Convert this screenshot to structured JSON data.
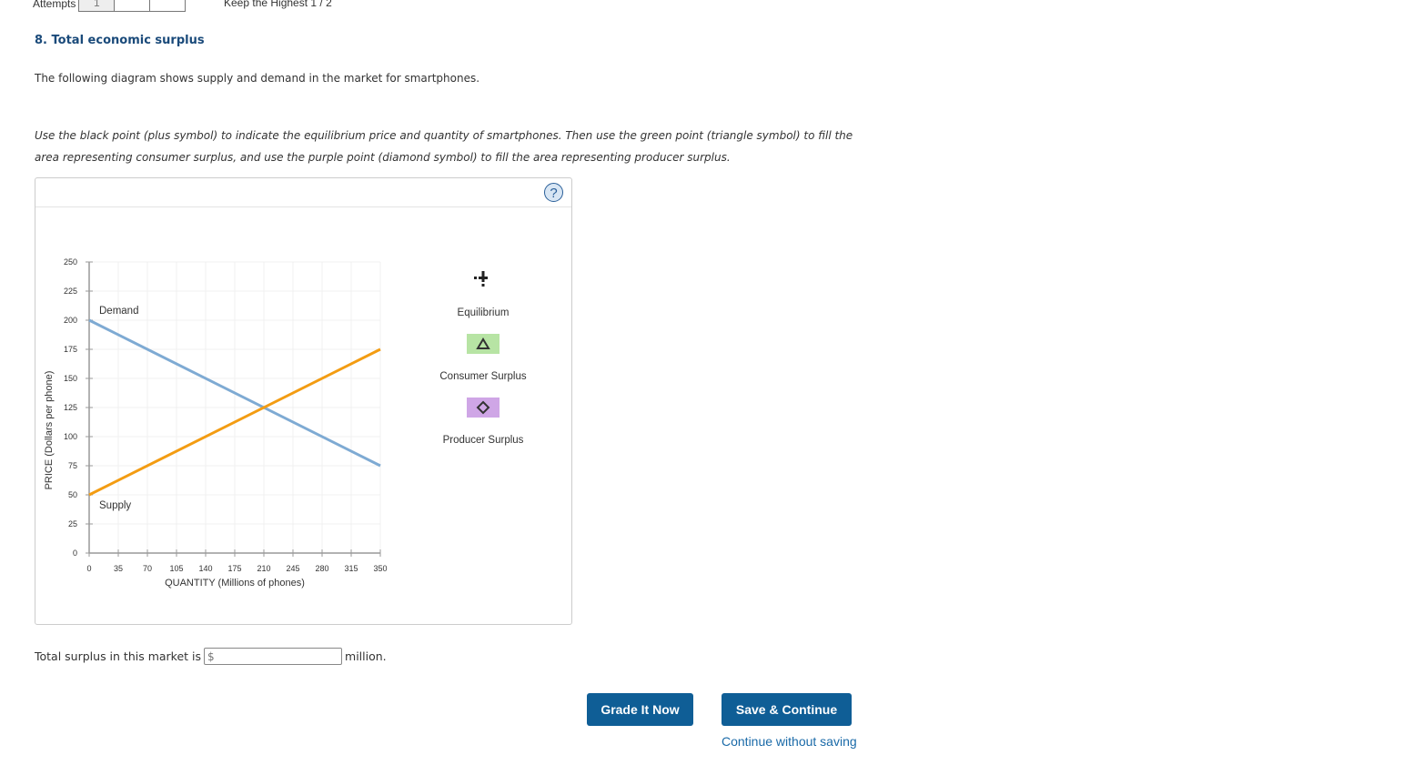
{
  "header": {
    "attempts_label": "Attempts",
    "attempts_boxes": [
      "1",
      "",
      ""
    ],
    "keep_highest": "Keep the Highest 1 / 2"
  },
  "question": {
    "title": "8. Total economic surplus",
    "intro": "The following diagram shows supply and demand in the market for smartphones.",
    "instructions": "Use the black point (plus symbol) to indicate the equilibrium price and quantity of smartphones. Then use the green point (triangle symbol) to fill the area representing consumer surplus, and use the purple point (diamond symbol) to fill the area representing producer surplus."
  },
  "graph": {
    "help_label": "?",
    "palette": [
      {
        "label": "Equilibrium",
        "icon": "plus-icon",
        "color": "#222222"
      },
      {
        "label": "Consumer Surplus",
        "icon": "triangle-icon",
        "color": "#b7e4a4"
      },
      {
        "label": "Producer Surplus",
        "icon": "diamond-icon",
        "color": "#cfa6e6"
      }
    ]
  },
  "chart_data": {
    "type": "line",
    "title": "",
    "xlabel": "QUANTITY (Millions of phones)",
    "ylabel": "PRICE (Dollars per phone)",
    "xlim": [
      0,
      350
    ],
    "ylim": [
      0,
      250
    ],
    "x_ticks": [
      0,
      35,
      70,
      105,
      140,
      175,
      210,
      245,
      280,
      315,
      350
    ],
    "y_ticks": [
      0,
      25,
      50,
      75,
      100,
      125,
      150,
      175,
      200,
      225,
      250
    ],
    "grid": true,
    "series": [
      {
        "name": "Demand",
        "color": "#7eaad3",
        "points": [
          [
            0,
            200
          ],
          [
            350,
            75
          ]
        ]
      },
      {
        "name": "Supply",
        "color": "#f39c12",
        "points": [
          [
            0,
            50
          ],
          [
            350,
            175
          ]
        ]
      }
    ]
  },
  "answer": {
    "prefix": "Total surplus in this market is",
    "placeholder": "$",
    "value": "",
    "suffix": "million."
  },
  "actions": {
    "grade": "Grade It Now",
    "save": "Save & Continue",
    "continue_link": "Continue without saving"
  }
}
